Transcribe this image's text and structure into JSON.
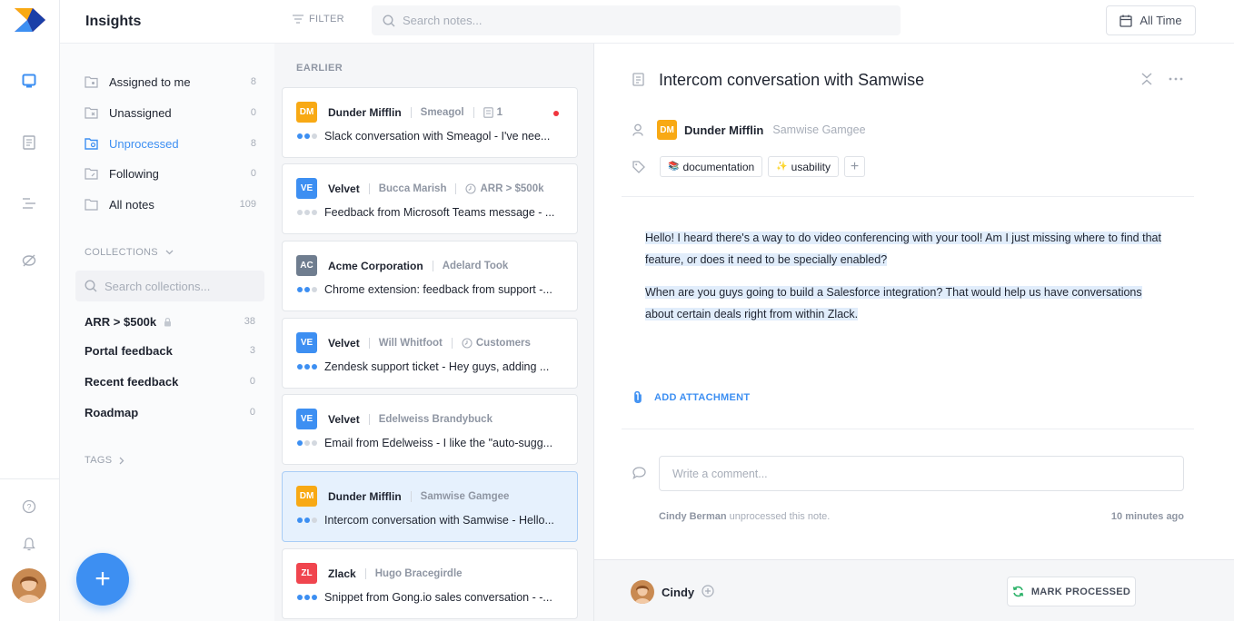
{
  "header": {
    "title": "Insights",
    "filter_label": "FILTER",
    "search_placeholder": "Search notes...",
    "date_range_label": "All Time"
  },
  "sidebar": {
    "nav": [
      {
        "label": "Assigned to me",
        "count": "8",
        "icon": "assigned-icon"
      },
      {
        "label": "Unassigned",
        "count": "0",
        "icon": "unassigned-icon"
      },
      {
        "label": "Unprocessed",
        "count": "8",
        "icon": "unprocessed-icon",
        "active": true
      },
      {
        "label": "Following",
        "count": "0",
        "icon": "following-icon"
      },
      {
        "label": "All notes",
        "count": "109",
        "icon": "folder-icon"
      }
    ],
    "collections_header": "COLLECTIONS",
    "collections_search_placeholder": "Search collections...",
    "collections": [
      {
        "label": "ARR > $500k",
        "count": "38",
        "locked": true
      },
      {
        "label": "Portal feedback",
        "count": "3"
      },
      {
        "label": "Recent feedback",
        "count": "0"
      },
      {
        "label": "Roadmap",
        "count": "0"
      }
    ],
    "tags_header": "TAGS"
  },
  "notes": {
    "section_label": "EARLIER",
    "items": [
      {
        "badge": "DM",
        "badge_color": "#f8a914",
        "company": "Dunder Mifflin",
        "person": "Smeagol",
        "meta": "1",
        "meta_icon": "note-icon",
        "unread": true,
        "dots": 2,
        "snippet": "Slack conversation with Smeagol - I've nee..."
      },
      {
        "badge": "VE",
        "badge_color": "#3d8ff2",
        "company": "Velvet",
        "person": "Bucca Marish",
        "meta": "ARR > $500k",
        "meta_icon": "clock-icon",
        "dots": 0,
        "snippet": "Feedback from Microsoft Teams message - ..."
      },
      {
        "badge": "AC",
        "badge_color": "#6f7d8f",
        "company": "Acme Corporation",
        "person": "Adelard Took",
        "meta": "",
        "dots": 2,
        "snippet": "Chrome extension: feedback from support -..."
      },
      {
        "badge": "VE",
        "badge_color": "#3d8ff2",
        "company": "Velvet",
        "person": "Will Whitfoot",
        "meta": "Customers",
        "meta_icon": "clock-icon",
        "dots": 3,
        "snippet": "Zendesk support ticket - Hey guys, adding ..."
      },
      {
        "badge": "VE",
        "badge_color": "#3d8ff2",
        "company": "Velvet",
        "person": "Edelweiss Brandybuck",
        "meta": "",
        "dots": 1,
        "snippet": "Email from Edelweiss - I like the \"auto-sugg..."
      },
      {
        "badge": "DM",
        "badge_color": "#f8a914",
        "company": "Dunder Mifflin",
        "person": "Samwise Gamgee",
        "meta": "",
        "dots": 2,
        "selected": true,
        "snippet": "Intercom conversation with Samwise - Hello..."
      },
      {
        "badge": "ZL",
        "badge_color": "#f0454e",
        "company": "Zlack",
        "person": "Hugo Bracegirdle",
        "meta": "",
        "dots": 3,
        "snippet": "Snippet from Gong.io sales conversation - -..."
      }
    ]
  },
  "detail": {
    "title": "Intercom conversation with Samwise",
    "company_badge": "DM",
    "company": "Dunder Mifflin",
    "person": "Samwise Gamgee",
    "tags": [
      {
        "label": "documentation",
        "emoji": "📚"
      },
      {
        "label": "usability",
        "emoji": "✨"
      }
    ],
    "paragraphs": [
      "Hello! I heard there's a way to do video conferencing with your tool! Am I just missing where to find that feature, or does it need to be specially enabled?",
      "When are you guys going to build a Salesforce integration? That would help us have conversations about certain deals right from within Zlack."
    ],
    "add_attachment_label": "ADD ATTACHMENT",
    "comment_placeholder": "Write a comment...",
    "activity_user": "Cindy Berman",
    "activity_text": "unprocessed this note.",
    "activity_time": "10 minutes ago"
  },
  "footer": {
    "assignee": "Cindy",
    "mark_processed_label": "MARK PROCESSED"
  },
  "colors": {
    "accent": "#3d8ff2",
    "unread": "#f0353e",
    "processed_green": "#2fb36b"
  }
}
